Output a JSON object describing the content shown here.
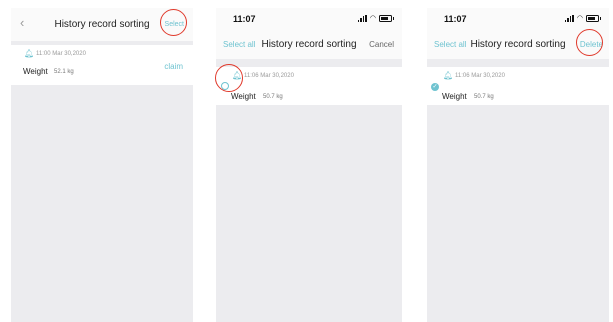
{
  "colors": {
    "accent": "#6fc3d0",
    "annotation": "#e0392b",
    "screen_bg": "#ececef"
  },
  "screen1": {
    "back_icon": "chevron-left-icon",
    "title": "History record sorting",
    "select_label": "Select",
    "record": {
      "bell_icon": "bell-icon",
      "timestamp": "11:00 Mar 30,2020",
      "weight_label": "Weight",
      "weight_value": "52.1 kg",
      "claim_label": "claim"
    }
  },
  "screen2": {
    "status": {
      "time": "11:07",
      "icons": [
        "signal-icon",
        "wifi-icon",
        "battery-icon"
      ]
    },
    "select_all_label": "Select all",
    "title": "History record sorting",
    "cancel_label": "Cancel",
    "record": {
      "selected": false,
      "timestamp": "11:06 Mar 30,2020",
      "weight_label": "Weight",
      "weight_value": "50.7 kg"
    }
  },
  "screen3": {
    "status": {
      "time": "11:07",
      "icons": [
        "signal-icon",
        "wifi-icon",
        "battery-icon"
      ]
    },
    "select_all_label": "Select all",
    "title": "History record sorting",
    "delete_label": "Delete",
    "record": {
      "selected": true,
      "timestamp": "11:06 Mar 30,2020",
      "weight_label": "Weight",
      "weight_value": "50.7 kg"
    }
  }
}
